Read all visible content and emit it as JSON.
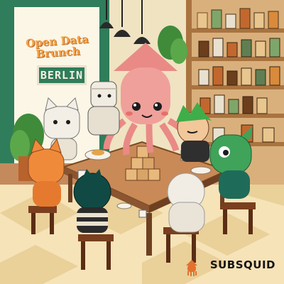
{
  "sign": {
    "title": "Open Data Brunch",
    "city": "BERLIN"
  },
  "brand": {
    "name": "SUBSQUID",
    "logo_icon": "squid-logo-icon"
  },
  "colors": {
    "floor_light": "#f6e3b8",
    "floor_dark": "#e9c98c",
    "wall_green": "#2f7d5a",
    "squid_pink": "#e98a86",
    "table_wood": "#b9774a",
    "brand_orange": "#e2712e"
  }
}
